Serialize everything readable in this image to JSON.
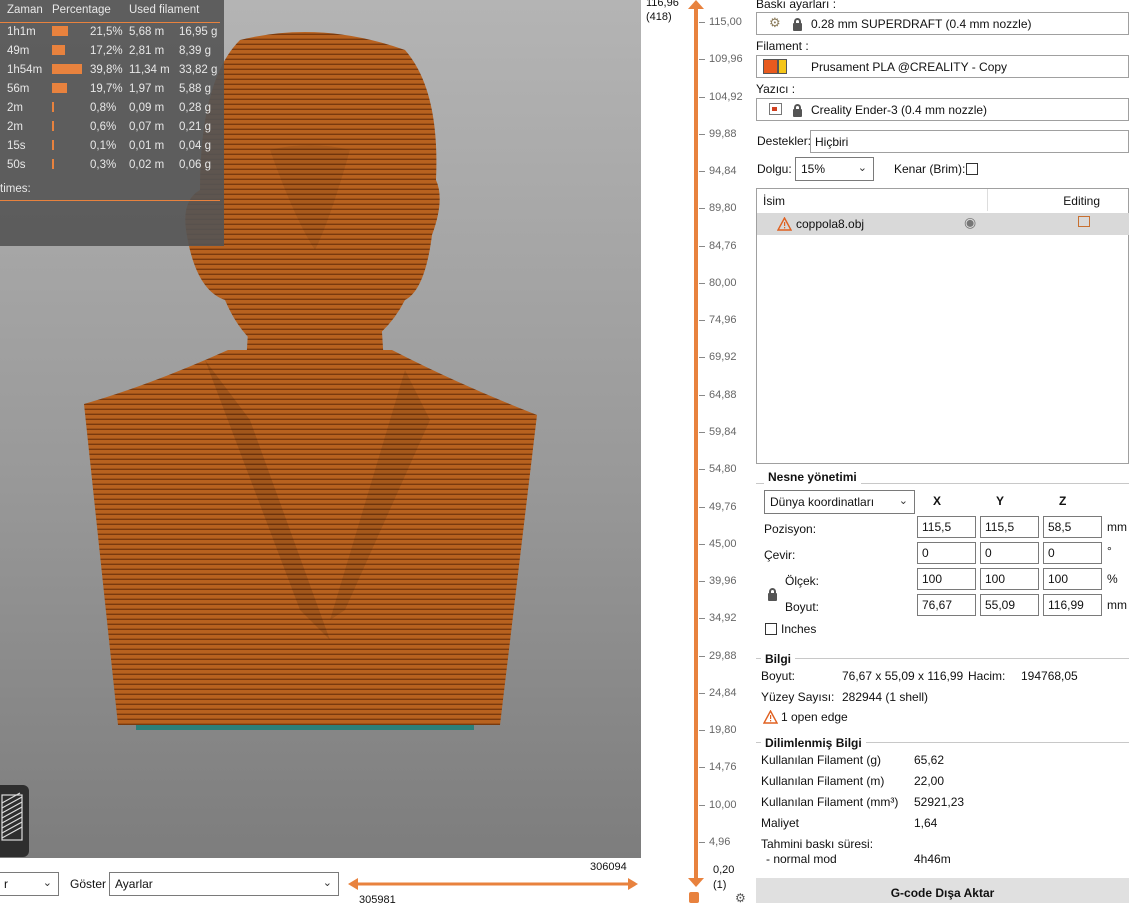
{
  "legend": {
    "headers": [
      "Zaman",
      "Percentage",
      "Used filament"
    ],
    "rows": [
      {
        "time": "1h1m",
        "pct": "21,5%",
        "pct_value": 21.5,
        "len": "5,68 m",
        "weight": "16,95 g"
      },
      {
        "time": "49m",
        "pct": "17,2%",
        "pct_value": 17.2,
        "len": "2,81 m",
        "weight": "8,39 g"
      },
      {
        "time": "1h54m",
        "pct": "39,8%",
        "pct_value": 39.8,
        "len": "11,34 m",
        "weight": "33,82 g"
      },
      {
        "time": "56m",
        "pct": "19,7%",
        "pct_value": 19.7,
        "len": "1,97 m",
        "weight": "5,88 g"
      },
      {
        "time": "2m",
        "pct": "0,8%",
        "pct_value": 0.8,
        "len": "0,09 m",
        "weight": "0,28 g"
      },
      {
        "time": "2m",
        "pct": "0,6%",
        "pct_value": 0.6,
        "len": "0,07 m",
        "weight": "0,21 g"
      },
      {
        "time": "15s",
        "pct": "0,1%",
        "pct_value": 0.1,
        "len": "0,01 m",
        "weight": "0,04 g"
      },
      {
        "time": "50s",
        "pct": "0,3%",
        "pct_value": 0.3,
        "len": "0,02 m",
        "weight": "0,06 g"
      }
    ],
    "times_label": "times:",
    "bar_color": "#e8823e"
  },
  "bottom": {
    "view_select": "r",
    "show_label": "Göster",
    "show_select": "Ayarlar",
    "move_top_value": "306094",
    "move_bottom_value": "305981"
  },
  "vslider": {
    "top_value": "116,96",
    "top_layer": "(418)",
    "ticks": [
      "115,00",
      "109,96",
      "104,92",
      "99,88",
      "94,84",
      "89,80",
      "84,76",
      "80,00",
      "74,96",
      "69,92",
      "64,88",
      "59,84",
      "54,80",
      "49,76",
      "45,00",
      "39,96",
      "34,92",
      "29,88",
      "24,84",
      "19,80",
      "14,76",
      "10,00",
      "4,96"
    ],
    "bottom_value": "0,20",
    "bottom_layer": "(1)",
    "accent": "#e8823e"
  },
  "panel": {
    "print_settings_label": "Baskı ayarları :",
    "print_settings_value": "0.28 mm SUPERDRAFT (0.4 mm nozzle)",
    "filament_label": "Filament :",
    "filament_value": "Prusament PLA @CREALITY - Copy",
    "printer_label": "Yazıcı :",
    "printer_value": "Creality Ender-3 (0.4 mm nozzle)",
    "supports_label": "Destekler:",
    "supports_value": "Hiçbiri",
    "infill_label": "Dolgu:",
    "infill_value": "15%",
    "brim_label": "Kenar (Brim):",
    "list_headers": {
      "name": "İsim",
      "editing": "Editing"
    },
    "object_name": "coppola8.obj",
    "object_manipulation": {
      "title": "Nesne yönetimi",
      "coord_select": "Dünya koordinatları",
      "axes": [
        "X",
        "Y",
        "Z"
      ],
      "position_label": "Pozisyon:",
      "position": [
        "115,5",
        "115,5",
        "58,5"
      ],
      "position_unit": "mm",
      "rotate_label": "Çevir:",
      "rotate": [
        "0",
        "0",
        "0"
      ],
      "rotate_unit": "°",
      "scale_label": "Ölçek:",
      "scale": [
        "100",
        "100",
        "100"
      ],
      "scale_unit": "%",
      "size_label": "Boyut:",
      "size": [
        "76,67",
        "55,09",
        "116,99"
      ],
      "size_unit": "mm",
      "inches_label": "Inches"
    },
    "info": {
      "title": "Bilgi",
      "size_label": "Boyut:",
      "size_value": "76,67 x 55,09 x 116,99",
      "volume_label": "Hacim:",
      "volume_value": "194768,05",
      "facets_label": "Yüzey Sayısı:",
      "facets_value": "282944 (1 shell)",
      "warning": "1 open edge"
    },
    "sliced": {
      "title": "Dilimlenmiş Bilgi",
      "rows": [
        {
          "label": "Kullanılan Filament (g)",
          "value": "65,62"
        },
        {
          "label": "Kullanılan Filament (m)",
          "value": "22,00"
        },
        {
          "label": "Kullanılan Filament (mm³)",
          "value": "52921,23"
        },
        {
          "label": "Maliyet",
          "value": "1,64"
        }
      ],
      "time_label": "Tahmini baskı süresi:",
      "mode_label": "- normal mod",
      "mode_value": "4h46m"
    },
    "export_button": "G-code Dışa Aktar"
  }
}
